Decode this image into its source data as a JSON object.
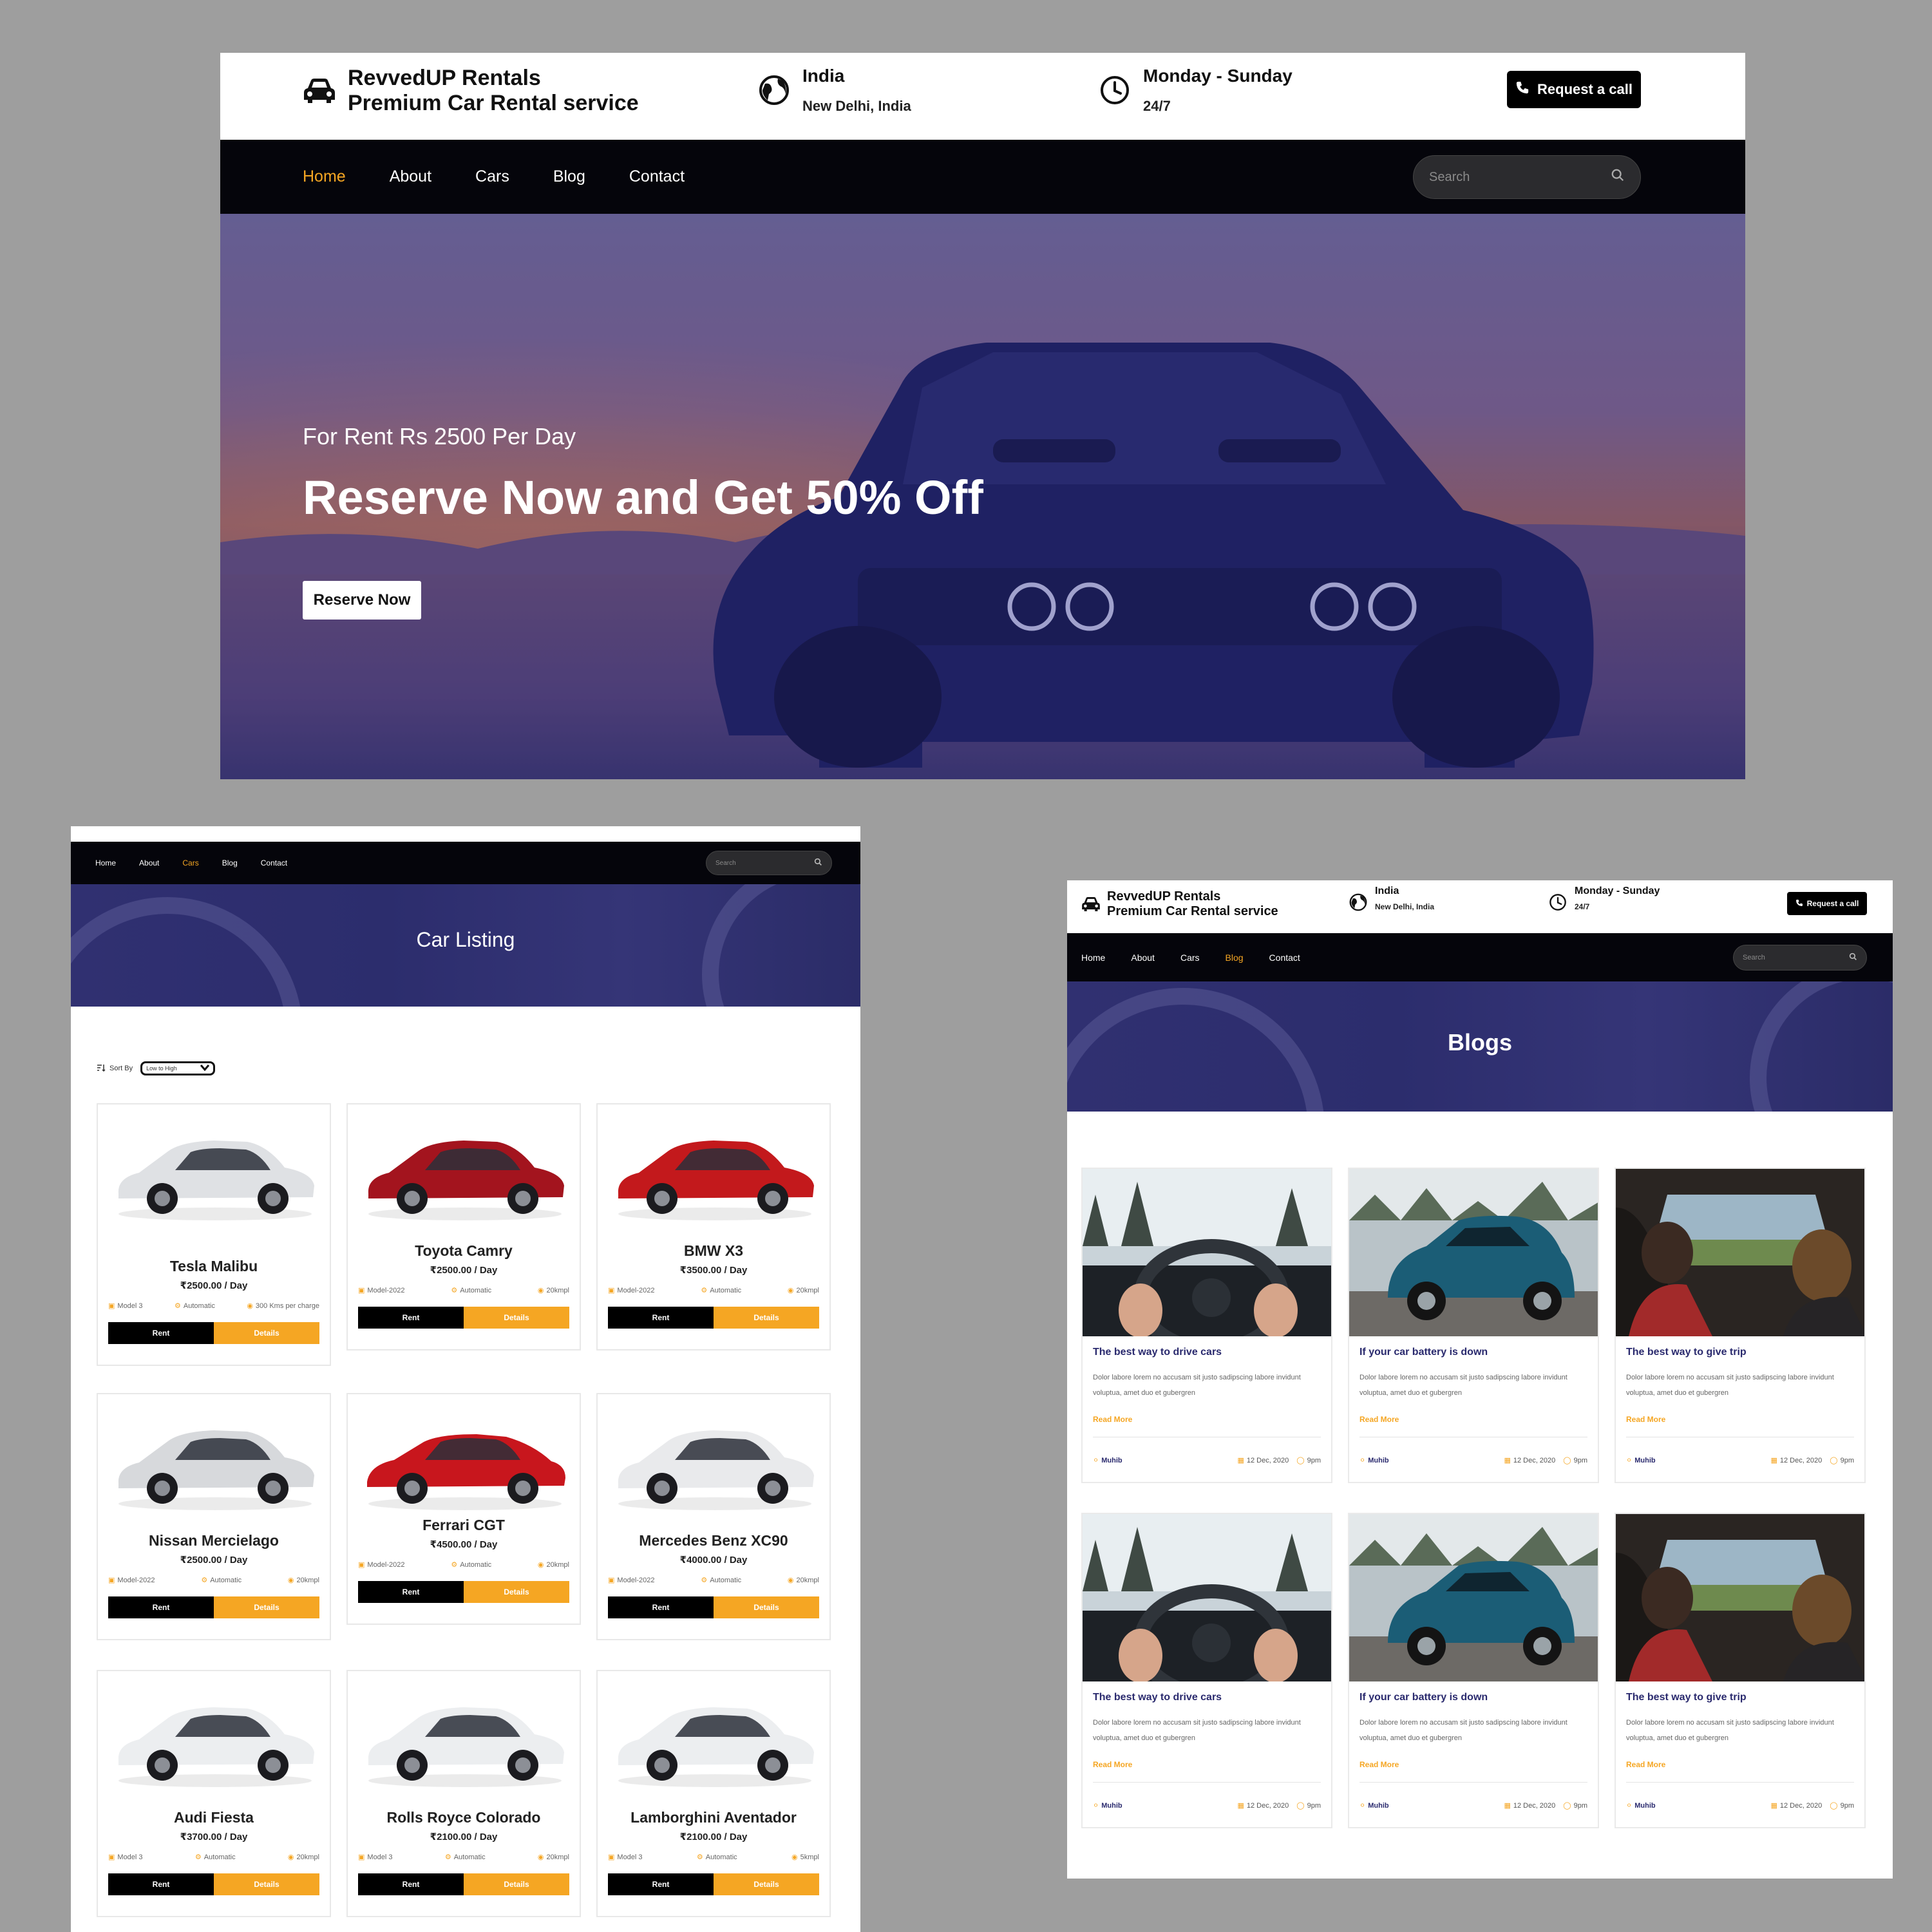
{
  "brand": {
    "line1": "RevvedUP Rentals",
    "line2": "Premium Car Rental service"
  },
  "location": {
    "title": "India",
    "subtitle": "New Delhi, India"
  },
  "hours": {
    "title": "Monday - Sunday",
    "subtitle": "24/7"
  },
  "call_button": "Request a call",
  "nav": [
    "Home",
    "About",
    "Cars",
    "Blog",
    "Contact"
  ],
  "search_placeholder": "Search",
  "hero": {
    "subtitle": "For Rent Rs 2500 Per Day",
    "title": "Reserve Now and Get 50% Off",
    "cta": "Reserve Now"
  },
  "car_listing": {
    "title": "Car Listing",
    "sort_label": "Sort By",
    "sort_value": "Low to High",
    "rent_label": "Rent",
    "details_label": "Details",
    "cars": [
      {
        "name": "Tesla Malibu",
        "price": "₹2500.00 / Day",
        "model": "Model 3",
        "trans": "Automatic",
        "range": "300 Kms per charge",
        "color": "#dfe1e4"
      },
      {
        "name": "Toyota Camry",
        "price": "₹2500.00 / Day",
        "model": "Model-2022",
        "trans": "Automatic",
        "range": "20kmpl",
        "color": "#a3141e"
      },
      {
        "name": "BMW X3",
        "price": "₹3500.00 / Day",
        "model": "Model-2022",
        "trans": "Automatic",
        "range": "20kmpl",
        "color": "#c3191c"
      },
      {
        "name": "Nissan Mercielago",
        "price": "₹2500.00 / Day",
        "model": "Model-2022",
        "trans": "Automatic",
        "range": "20kmpl",
        "color": "#d7d9dc"
      },
      {
        "name": "Ferrari CGT",
        "price": "₹4500.00 / Day",
        "model": "Model-2022",
        "trans": "Automatic",
        "range": "20kmpl",
        "color": "#c8161d"
      },
      {
        "name": "Mercedes Benz XC90",
        "price": "₹4000.00 / Day",
        "model": "Model-2022",
        "trans": "Automatic",
        "range": "20kmpl",
        "color": "#e9eaec"
      },
      {
        "name": "Audi Fiesta",
        "price": "₹3700.00 / Day",
        "model": "Model 3",
        "trans": "Automatic",
        "range": "20kmpl",
        "color": "#eceef0"
      },
      {
        "name": "Rolls Royce Colorado",
        "price": "₹2100.00 / Day",
        "model": "Model 3",
        "trans": "Automatic",
        "range": "20kmpl",
        "color": "#eceef0"
      },
      {
        "name": "Lamborghini Aventador",
        "price": "₹2100.00 / Day",
        "model": "Model 3",
        "trans": "Automatic",
        "range": "5kmpl",
        "color": "#eceef0"
      }
    ]
  },
  "blogs": {
    "title": "Blogs",
    "read_more": "Read More",
    "text": "Dolor labore lorem no accusam sit justo sadipscing labore invidunt voluptua, amet duo et gubergren",
    "posts": [
      {
        "title": "The best way to drive cars",
        "author": "Muhib",
        "date": "12 Dec, 2020",
        "time": "9pm",
        "scene": "winter"
      },
      {
        "title": "If your car battery is down",
        "author": "Muhib",
        "date": "12 Dec, 2020",
        "time": "9pm",
        "scene": "bluecar"
      },
      {
        "title": "The best way to give trip",
        "author": "Muhib",
        "date": "12 Dec, 2020",
        "time": "9pm",
        "scene": "trip"
      },
      {
        "title": "The best way to drive cars",
        "author": "Muhib",
        "date": "12 Dec, 2020",
        "time": "9pm",
        "scene": "winter"
      },
      {
        "title": "If your car battery is down",
        "author": "Muhib",
        "date": "12 Dec, 2020",
        "time": "9pm",
        "scene": "bluecar"
      },
      {
        "title": "The best way to give trip",
        "author": "Muhib",
        "date": "12 Dec, 2020",
        "time": "9pm",
        "scene": "trip"
      }
    ]
  },
  "colors": {
    "accent": "#f5a623",
    "navbar": "#05050b",
    "blog_title": "#2a2a6e"
  }
}
